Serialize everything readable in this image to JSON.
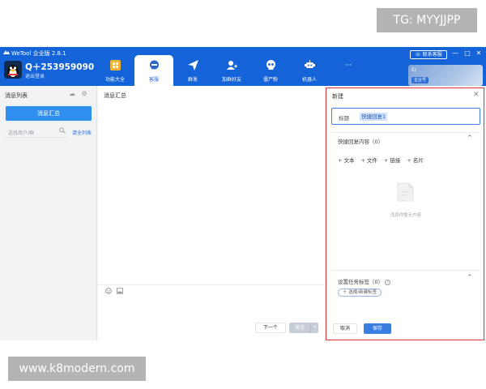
{
  "watermarks": {
    "tg": "TG: MYYJJPP",
    "site": "www.k8modern.com"
  },
  "app": {
    "title": "WeTool 企业版 2.8.1",
    "user_name": "Q＋253959090",
    "user_sub": "退出登录",
    "contact_label": "联系客服",
    "profile_name": "E/",
    "profile_badge": "企业号",
    "window_controls": [
      "—",
      "□",
      "✕"
    ],
    "accent_color": "#1463d8"
  },
  "nav": {
    "items": [
      {
        "label": "功能大全",
        "icon": "grid-icon"
      },
      {
        "label": "客服",
        "icon": "chat-bubble-icon"
      },
      {
        "label": "群发",
        "icon": "paper-plane-icon"
      },
      {
        "label": "加群好友",
        "icon": "add-user-icon"
      },
      {
        "label": "僵尸粉",
        "icon": "skull-icon"
      },
      {
        "label": "机器人",
        "icon": "robot-icon"
      },
      {
        "label": "···",
        "icon": "more-icon"
      }
    ]
  },
  "left": {
    "title": "消息列表",
    "summary_button": "消息汇总",
    "search_placeholder": "送找用户/群",
    "all_list_link": "请全列表"
  },
  "middle": {
    "title": "消息汇总",
    "next_button": "下一个",
    "send_button": "发送",
    "send_dropdown": "▾"
  },
  "dialog": {
    "title": "新建",
    "close": "✕",
    "title_label": "标题",
    "title_value": "快捷回复1",
    "quick_reply_section": "快捷回复内容（0）",
    "types": [
      "文本",
      "文件",
      "链接",
      "名片"
    ],
    "empty_text": "消息你暂无内容",
    "task_tag_section": "设置任务标签（0）",
    "help": "?",
    "tag_button": "＋ 选择/新建标签",
    "cancel_button": "取消",
    "save_button": "保存",
    "highlight_color": "#e0333a"
  }
}
